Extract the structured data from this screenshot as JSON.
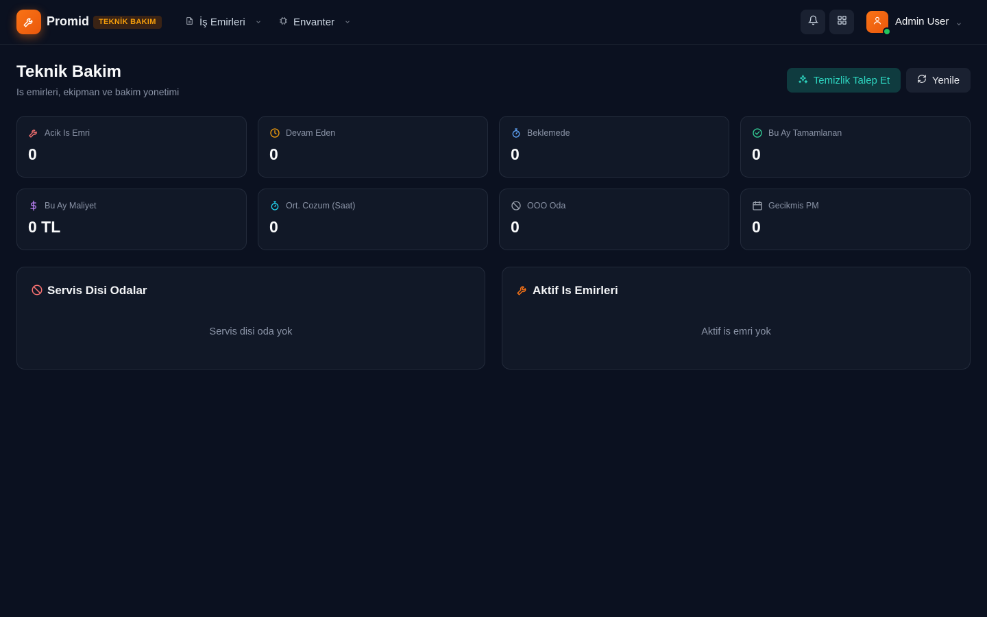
{
  "brand": {
    "name": "Promid",
    "badge": "TEKNİK BAKIM",
    "accent": "#f97316"
  },
  "nav": [
    {
      "label": "İş Emirleri",
      "icon": "document-icon"
    },
    {
      "label": "Envanter",
      "icon": "chip-icon"
    }
  ],
  "header_actions": {
    "icons": [
      "bell-icon",
      "grid-icon"
    ]
  },
  "user": {
    "name": "Admin User",
    "status": "online"
  },
  "page": {
    "title": "Teknik Bakim",
    "subtitle": "Is emirleri, ekipman ve bakim yonetimi",
    "primary_button": "Temizlik Talep Et",
    "secondary_button": "Yenile"
  },
  "stats": [
    {
      "label": "Acik Is Emri",
      "value": "0",
      "icon": "wrench-icon",
      "color": "#f87171"
    },
    {
      "label": "Devam Eden",
      "value": "0",
      "icon": "clock-icon",
      "color": "#f59e0b"
    },
    {
      "label": "Beklemede",
      "value": "0",
      "icon": "timer-icon",
      "color": "#60a5fa"
    },
    {
      "label": "Bu Ay Tamamlanan",
      "value": "0",
      "icon": "check-circle-icon",
      "color": "#34d399"
    },
    {
      "label": "Bu Ay Maliyet",
      "value": "0 TL",
      "icon": "dollar-icon",
      "color": "#c084fc"
    },
    {
      "label": "Ort. Cozum (Saat)",
      "value": "0",
      "icon": "stopwatch-icon",
      "color": "#22d3ee"
    },
    {
      "label": "OOO Oda",
      "value": "0",
      "icon": "ban-icon",
      "color": "#9ca3af"
    },
    {
      "label": "Gecikmis PM",
      "value": "0",
      "icon": "calendar-icon",
      "color": "#9ca3af"
    }
  ],
  "panels": [
    {
      "title": "Servis Disi Odalar",
      "empty": "Servis disi oda yok",
      "icon": "ban-icon",
      "color": "#f87171"
    },
    {
      "title": "Aktif Is Emirleri",
      "empty": "Aktif is emri yok",
      "icon": "wrench-icon",
      "color": "#f97316"
    }
  ]
}
